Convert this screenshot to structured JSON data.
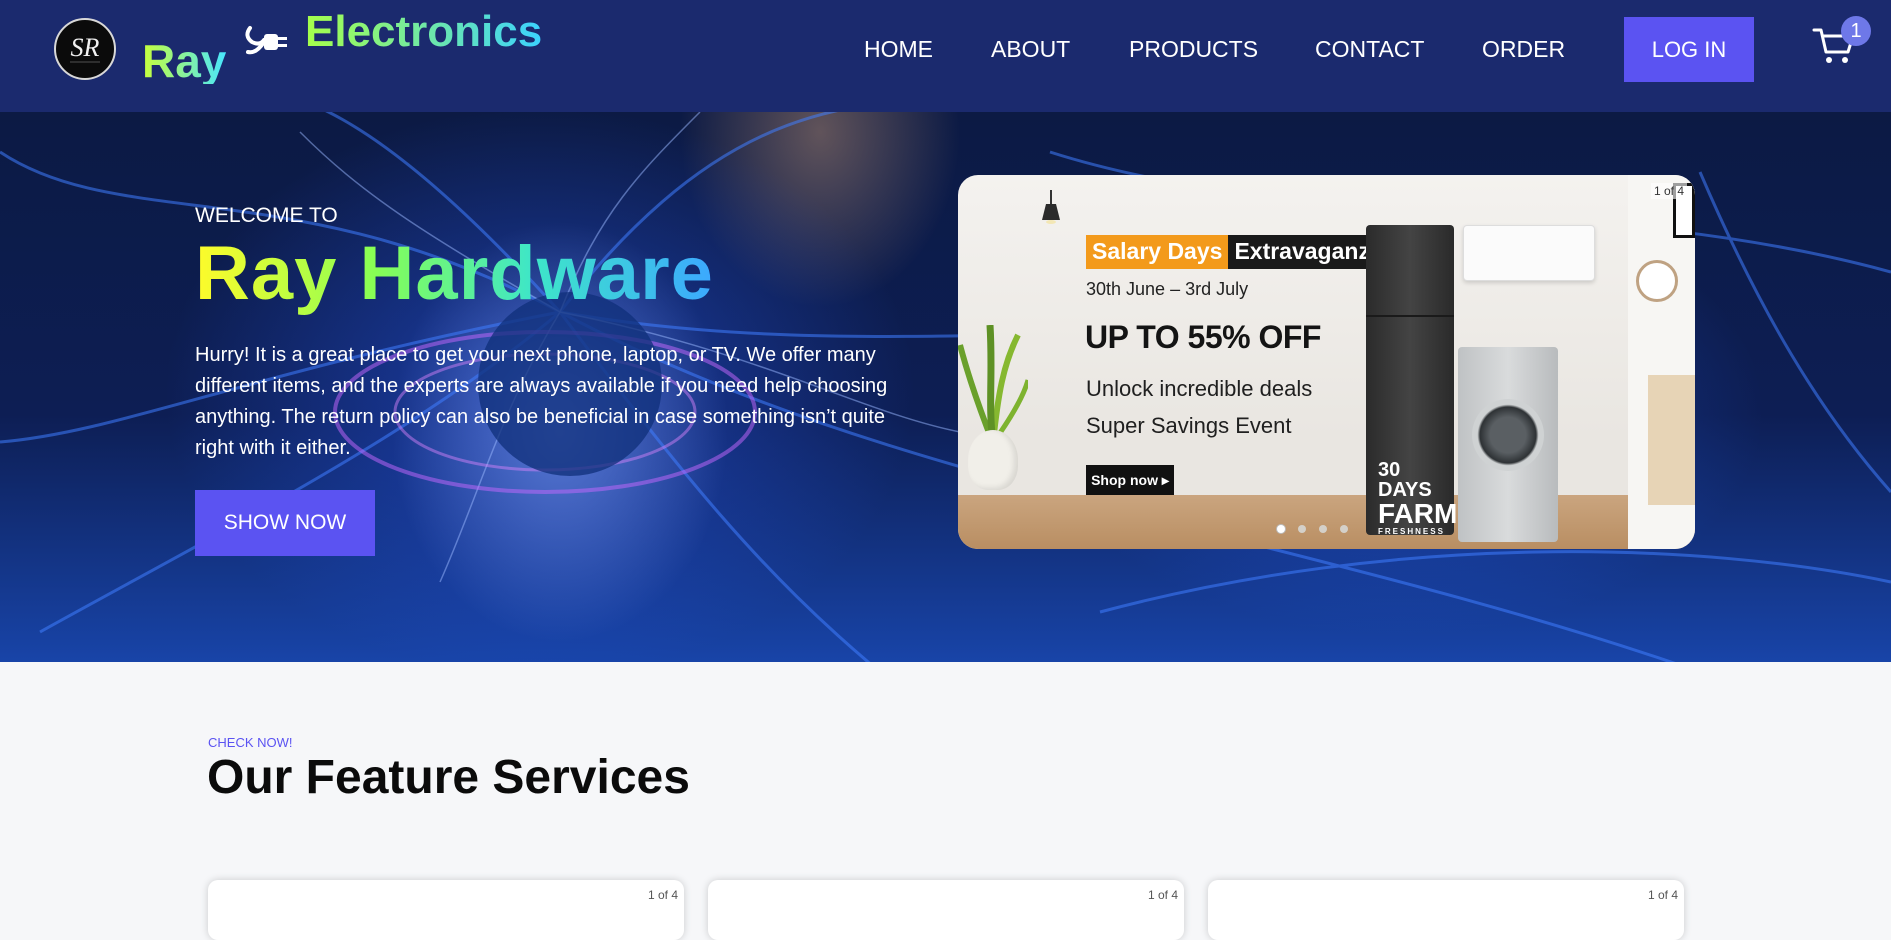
{
  "header": {
    "logo_text": "SR",
    "brand_ray": "Ray",
    "brand_electronics": "Electronics",
    "nav": [
      "HOME",
      "ABOUT",
      "PRODUCTS",
      "CONTACT",
      "ORDER"
    ],
    "login_label": "LOG IN",
    "cart_count": "1"
  },
  "hero": {
    "welcome": "WELCOME TO",
    "title": "Ray Hardware",
    "description": "Hurry! It is a great place to get your next phone, laptop, or TV. We offer many different items, and the experts are always available if you need help choosing anything. The return policy can also be beneficial in case something isn’t quite right with it either.",
    "cta_label": "SHOW NOW"
  },
  "banner": {
    "slide_counter": "1 of 4",
    "tag_left": "Salary Days",
    "tag_right": "Extravaganza",
    "dates": "30th June – 3rd July",
    "offer": "UP TO 55% OFF",
    "line1": "Unlock incredible deals",
    "line2": "Super Savings Event",
    "shop_label": "Shop now ▸",
    "fridge_line1": "30 DAYS",
    "fridge_line2": "FARM",
    "fridge_line3": "FRESHNESS",
    "dots": 4,
    "active_dot": 0
  },
  "services": {
    "kicker": "CHECK NOW!",
    "title": "Our Feature Services",
    "cards": [
      {
        "counter": "1 of 4"
      },
      {
        "counter": "1 of 4"
      },
      {
        "counter": "1 of 4"
      }
    ]
  },
  "colors": {
    "header_bg": "#1b2a6e",
    "accent": "#5b53f2"
  }
}
